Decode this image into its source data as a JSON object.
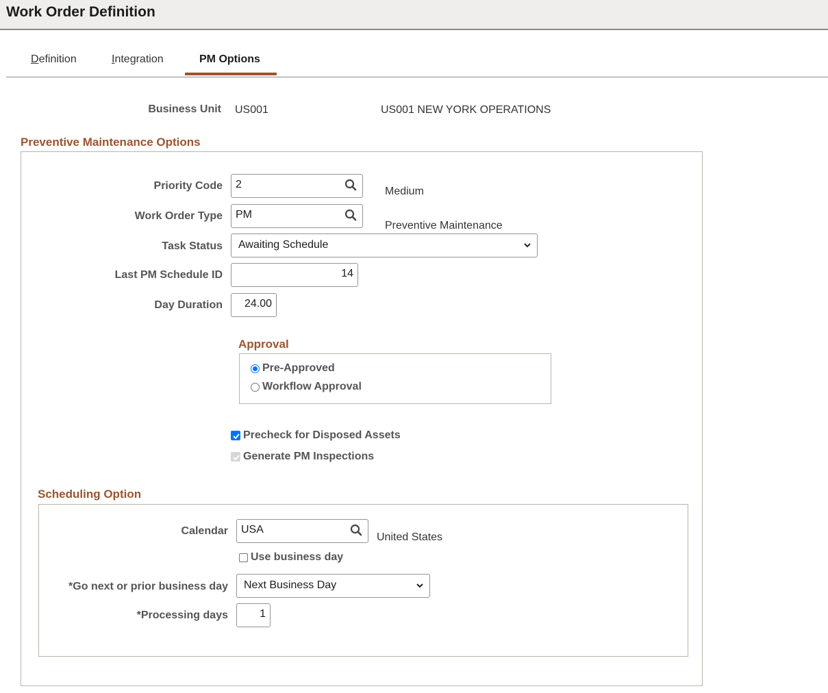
{
  "header": {
    "title": "Work Order Definition"
  },
  "tabs": [
    {
      "label": "Definition",
      "accesskey": "D",
      "rest": "efinition",
      "active": false
    },
    {
      "label": "Integration",
      "accesskey": "I",
      "rest": "ntegration",
      "active": false
    },
    {
      "label": "PM Options",
      "active": true
    }
  ],
  "business_unit": {
    "label": "Business Unit",
    "value": "US001",
    "description": "US001 NEW YORK OPERATIONS"
  },
  "pm_options": {
    "title": "Preventive Maintenance Options",
    "priority_code": {
      "label": "Priority Code",
      "value": "2",
      "description": "Medium"
    },
    "work_order_type": {
      "label": "Work Order Type",
      "value": "PM",
      "description": "Preventive Maintenance"
    },
    "task_status": {
      "label": "Task Status",
      "value": "Awaiting Schedule"
    },
    "last_pm_schedule_id": {
      "label": "Last PM Schedule ID",
      "value": "14"
    },
    "day_duration": {
      "label": "Day Duration",
      "value": "24.00"
    },
    "approval": {
      "title": "Approval",
      "options": [
        {
          "label": "Pre-Approved",
          "selected": true
        },
        {
          "label": "Workflow Approval",
          "selected": false
        }
      ]
    },
    "precheck_disposed_assets": {
      "label": "Precheck for Disposed Assets",
      "checked": true
    },
    "generate_pm_inspections": {
      "label": "Generate PM Inspections",
      "checked": true,
      "disabled": true
    }
  },
  "scheduling": {
    "title": "Scheduling Option",
    "calendar": {
      "label": "Calendar",
      "value": "USA",
      "description": "United States"
    },
    "use_business_day": {
      "label": "Use business day",
      "checked": false
    },
    "go_next_prior": {
      "label": "*Go next or prior business day",
      "value": "Next Business Day"
    },
    "processing_days": {
      "label": "*Processing days",
      "value": "1"
    }
  },
  "colors": {
    "accent": "#9b5430",
    "tab_underline": "#a0522d",
    "checkbox": "#0075ff"
  }
}
